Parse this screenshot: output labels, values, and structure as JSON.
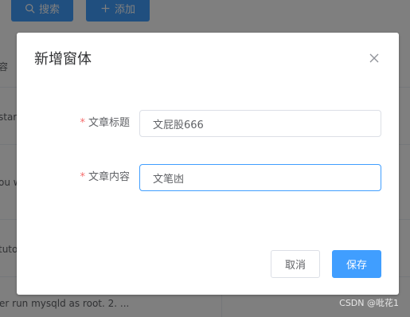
{
  "toolbar": {
    "search_label": "搜索",
    "add_label": "添加",
    "accent_color": "#409eff"
  },
  "table": {
    "header_fragment": "容",
    "rows": [
      "star",
      "ou w",
      "tuto",
      "er run mysqld as root. 2. ..."
    ]
  },
  "dialog": {
    "title": "新增窗体",
    "close_icon": "close-icon",
    "fields": [
      {
        "required_mark": "*",
        "label": "文章标题",
        "value": "文屁股666"
      },
      {
        "required_mark": "*",
        "label": "文章内容",
        "value": "文笔凼"
      }
    ],
    "cancel_label": "取消",
    "save_label": "保存"
  },
  "watermark": "CSDN @吡花1"
}
